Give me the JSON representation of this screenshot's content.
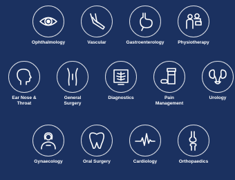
{
  "colors": {
    "background": "#1b3160",
    "icon_stroke": "#ffffff",
    "text": "#ffffff"
  },
  "specialties": [
    {
      "label": "Ophthalmology",
      "icon": "eye-icon"
    },
    {
      "label": "Vascular",
      "icon": "vascular-leg-icon"
    },
    {
      "label": "Gastroenterology",
      "icon": "stomach-icon"
    },
    {
      "label": "Physiotherapy",
      "icon": "physiotherapy-icon"
    },
    {
      "label": "Ear Nose &\nThroat",
      "icon": "head-profile-icon"
    },
    {
      "label": "General\nSurgery",
      "icon": "torso-icon"
    },
    {
      "label": "Diagnostics",
      "icon": "x-ray-screen-icon"
    },
    {
      "label": "Pain\nManagement",
      "icon": "pill-bottle-icon"
    },
    {
      "label": "Urology",
      "icon": "kidneys-icon"
    },
    {
      "label": "Gynaecology",
      "icon": "female-icon"
    },
    {
      "label": "Oral Surgery",
      "icon": "tooth-icon"
    },
    {
      "label": "Cardiology",
      "icon": "heartbeat-icon"
    },
    {
      "label": "Orthopaedics",
      "icon": "bone-joint-icon"
    }
  ]
}
